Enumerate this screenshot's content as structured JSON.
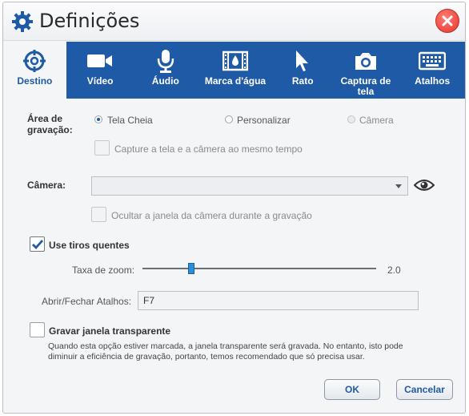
{
  "window": {
    "title": "Definições"
  },
  "tabs": [
    {
      "label": "Destino",
      "icon": "crosshair-icon",
      "active": true
    },
    {
      "label": "Vídeo",
      "icon": "video-camera-icon",
      "active": false
    },
    {
      "label": "Áudio",
      "icon": "microphone-icon",
      "active": false
    },
    {
      "label": "Marca d'água",
      "icon": "watermark-film-icon",
      "active": false
    },
    {
      "label": "Rato",
      "icon": "mouse-pointer-icon",
      "active": false
    },
    {
      "label": "Captura de tela",
      "icon": "camera-icon",
      "active": false
    },
    {
      "label": "Atalhos",
      "icon": "keyboard-icon",
      "active": false
    }
  ],
  "recording_area": {
    "label": "Área de gravação:",
    "options": [
      {
        "label": "Tela Cheia",
        "selected": true,
        "enabled": true
      },
      {
        "label": "Personalizar",
        "selected": false,
        "enabled": true
      },
      {
        "label": "Câmera",
        "selected": false,
        "enabled": false
      }
    ],
    "capture_both_label": "Capture a tela e a câmera ao mesmo tempo"
  },
  "camera": {
    "label": "Câmera:",
    "selected": "",
    "hide_window_label": "Ocultar a janela da câmera durante a gravação"
  },
  "hotshots": {
    "label": "Use tiros quentes",
    "checked": true,
    "zoom_label": "Taxa de zoom:",
    "zoom_value": "2.0",
    "zoom_fraction": 0.2,
    "shortcut_label": "Abrir/Fechar Atalhos:",
    "shortcut_value": "F7"
  },
  "transparent": {
    "label": "Gravar janela transparente",
    "checked": false,
    "description": "Quando esta opção estiver marcada, a janela transparente será gravada. No entanto, isto pode diminuir a eficiência de gravação, portanto, temos recomendado que só precisa usar."
  },
  "buttons": {
    "ok": "OK",
    "cancel": "Cancelar"
  },
  "colors": {
    "accent": "#1f5aa6",
    "close": "#e2392f",
    "slider_thumb": "#2a8fd8"
  }
}
